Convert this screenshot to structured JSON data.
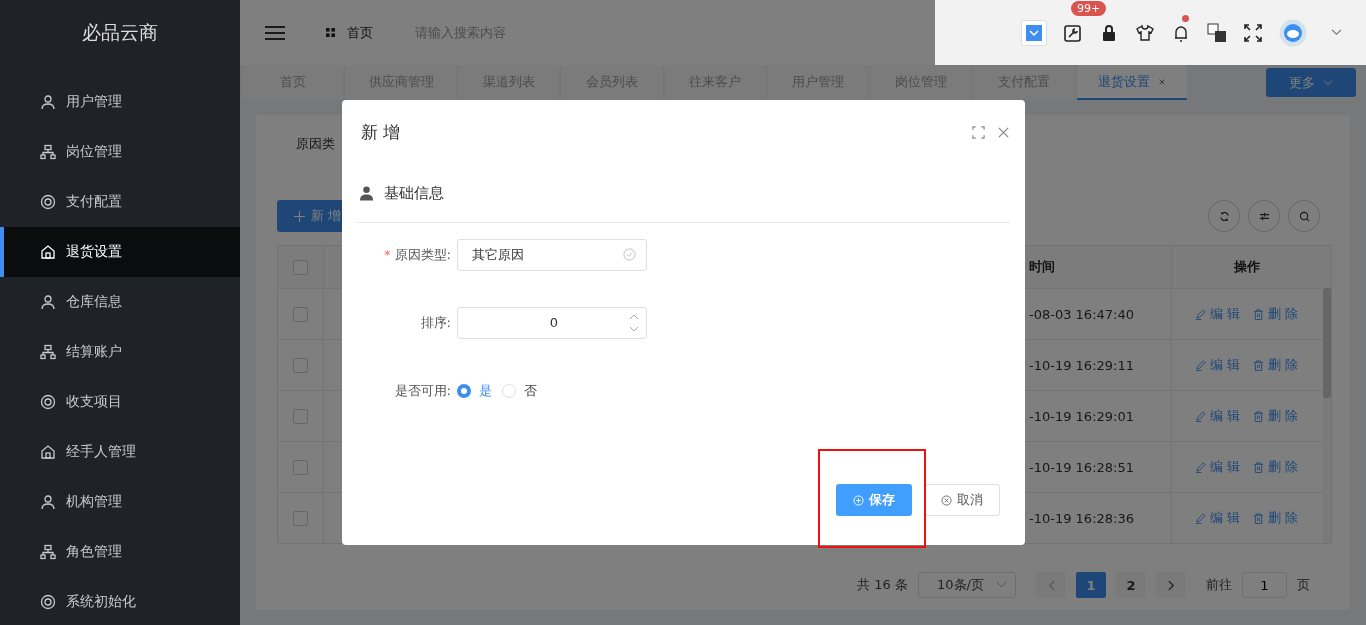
{
  "sidebar": {
    "title": "必品云商",
    "items": [
      {
        "label": "用户管理",
        "selected": false
      },
      {
        "label": "岗位管理",
        "selected": false
      },
      {
        "label": "支付配置",
        "selected": false
      },
      {
        "label": "退货设置",
        "selected": true
      },
      {
        "label": "仓库信息",
        "selected": false
      },
      {
        "label": "结算账户",
        "selected": false
      },
      {
        "label": "收支项目",
        "selected": false
      },
      {
        "label": "经手人管理",
        "selected": false
      },
      {
        "label": "机构管理",
        "selected": false
      },
      {
        "label": "角色管理",
        "selected": false
      },
      {
        "label": "系统初始化",
        "selected": false
      }
    ]
  },
  "header": {
    "breadcrumb": "首页",
    "search": {
      "placeholder": "请输入搜索内容"
    },
    "badge": "99+",
    "bell_dot": true
  },
  "tabs": [
    {
      "label": "首页",
      "selected": false,
      "closable": false
    },
    {
      "label": "供应商管理",
      "selected": false,
      "closable": false
    },
    {
      "label": "渠道列表",
      "selected": false,
      "closable": false
    },
    {
      "label": "会员列表",
      "selected": false,
      "closable": false
    },
    {
      "label": "往来客户",
      "selected": false,
      "closable": false
    },
    {
      "label": "用户管理",
      "selected": false,
      "closable": false
    },
    {
      "label": "岗位管理",
      "selected": false,
      "closable": false
    },
    {
      "label": "支付配置",
      "selected": false,
      "closable": false
    },
    {
      "label": "退货设置",
      "selected": true,
      "closable": true
    }
  ],
  "more_button": "更多",
  "filter": {
    "label": "原因类"
  },
  "add_button": "新 增",
  "table": {
    "header": {
      "checked": false,
      "column_3": "时间",
      "column_4": "操作"
    },
    "rows": [
      {
        "checked": false,
        "column_3": "-08-03 16:47:40",
        "edit": "编 辑",
        "delete": "删 除"
      },
      {
        "checked": false,
        "column_3": "-10-19 16:29:11",
        "edit": "编 辑",
        "delete": "删 除"
      },
      {
        "checked": false,
        "column_3": "-10-19 16:29:01",
        "edit": "编 辑",
        "delete": "删 除"
      },
      {
        "checked": false,
        "column_3": "-10-19 16:28:51",
        "edit": "编 辑",
        "delete": "删 除"
      },
      {
        "checked": false,
        "column_3": "-10-19 16:28:36",
        "edit": "编 辑",
        "delete": "删 除"
      }
    ]
  },
  "pagination": {
    "total": "共 16 条",
    "page_size": "10条/页",
    "pages": [
      {
        "label": "1",
        "selected": true
      },
      {
        "label": "2",
        "selected": false
      }
    ],
    "goto_label": "前往",
    "goto_value": "1",
    "page_suffix": "页"
  },
  "dialog": {
    "title": "新 增",
    "section": "基础信息",
    "fields": [
      {
        "kind": "select",
        "label": "原因类型:",
        "required_mark": "*",
        "value": "其它原因"
      },
      {
        "kind": "number",
        "label": "排序:",
        "value": "0"
      },
      {
        "kind": "radio",
        "label": "是否可用:",
        "options": [
          {
            "label": "是",
            "selected": true
          },
          {
            "label": "否",
            "selected": false
          }
        ]
      }
    ],
    "save_button": {
      "label": "保存",
      "highlighted": true
    },
    "cancel_button": "取消"
  }
}
